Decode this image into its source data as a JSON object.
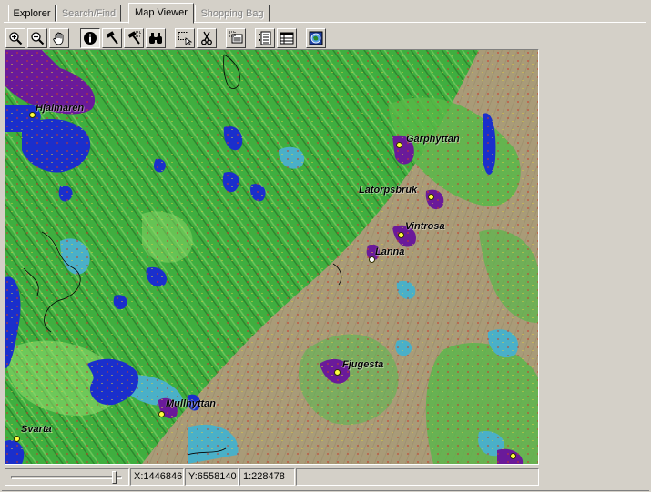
{
  "tabs": [
    {
      "label": "Explorer",
      "state": "normal"
    },
    {
      "label": "Search/Find",
      "state": "disabled"
    },
    {
      "label": "Map Viewer",
      "state": "active"
    },
    {
      "label": "Shopping Bag",
      "state": "disabled"
    }
  ],
  "toolbar": {
    "tools": [
      {
        "name": "zoom-in-icon"
      },
      {
        "name": "zoom-out-icon"
      },
      {
        "name": "pan-hand-icon"
      },
      {
        "name": "info-icon",
        "pressed": true
      },
      {
        "name": "hammer-icon"
      },
      {
        "name": "hammer-select-icon"
      },
      {
        "name": "binoculars-icon"
      },
      {
        "name": "select-area-icon"
      },
      {
        "name": "scissors-icon"
      },
      {
        "name": "image-stack-icon"
      },
      {
        "name": "legend-list-icon"
      },
      {
        "name": "table-icon"
      },
      {
        "name": "globe-icon"
      }
    ]
  },
  "map": {
    "places": [
      {
        "label": "Hjalmaren",
        "dot": "yellow"
      },
      {
        "label": "Garphyttan",
        "dot": "yellow"
      },
      {
        "label": "Latorpsbruk",
        "dot": "yellow"
      },
      {
        "label": "Vintrosa",
        "dot": "yellow"
      },
      {
        "label": "Lanna",
        "dot": "white"
      },
      {
        "label": "Fjugesta",
        "dot": "yellow"
      },
      {
        "label": "Mullhyttan",
        "dot": "yellow"
      },
      {
        "label": "Svarta",
        "dot": "yellow"
      }
    ],
    "colors": {
      "forest": "#3cae3c",
      "plain": "#a89a78",
      "water": "#1a2fcc",
      "urban": "#6a1a9a",
      "wetland": "#4ab0c8"
    }
  },
  "status": {
    "zoom_slider": 0.95,
    "x": "X:1446846",
    "y": "Y:6558140",
    "scale": "1:228478",
    "message": ""
  }
}
